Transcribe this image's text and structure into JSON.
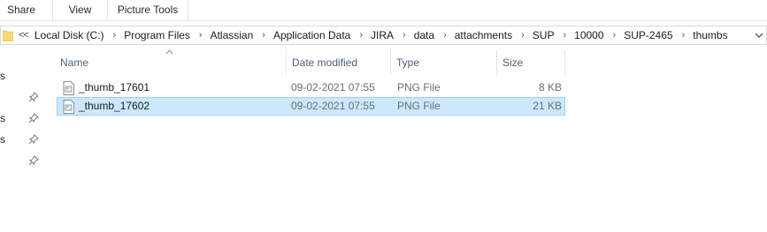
{
  "ribbon": {
    "tabs": [
      {
        "label": "Share"
      },
      {
        "label": "View"
      },
      {
        "label": "Picture Tools"
      }
    ]
  },
  "address_bar": {
    "overflow_label": "<<",
    "breadcrumbs": [
      "Local Disk (C:)",
      "Program Files",
      "Atlassian",
      "Application Data",
      "JIRA",
      "data",
      "attachments",
      "SUP",
      "10000",
      "SUP-2465",
      "thumbs"
    ],
    "separator": "›"
  },
  "nav_pane": {
    "fragments": [
      "s",
      "s",
      "s"
    ],
    "pin_icon": "pin-icon"
  },
  "columns": {
    "name": "Name",
    "date": "Date modified",
    "type": "Type",
    "size": "Size"
  },
  "files": [
    {
      "name": "_thumb_17601",
      "date": "09-02-2021 07:55",
      "type": "PNG File",
      "size": "8 KB",
      "selected": false
    },
    {
      "name": "_thumb_17602",
      "date": "09-02-2021 07:55",
      "type": "PNG File",
      "size": "21 KB",
      "selected": true
    }
  ],
  "colors": {
    "selection_bg": "#cce8ff",
    "selection_border": "#99d1ff",
    "header_text": "#4c607a",
    "folder_yellow": "#f8d775"
  }
}
